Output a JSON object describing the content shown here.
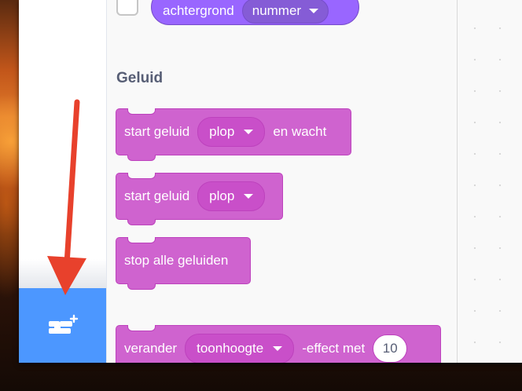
{
  "flyout": {
    "looks_block": {
      "label": "achtergrond",
      "dropdown_value": "nummer"
    },
    "section_sound": {
      "title": "Geluid"
    },
    "blocks": [
      {
        "prefix": "start geluid",
        "dropdown": "plop",
        "suffix": "en wacht"
      },
      {
        "prefix": "start geluid",
        "dropdown": "plop"
      },
      {
        "label": "stop alle geluiden"
      },
      {
        "prefix": "verander",
        "dropdown": "toonhoogte",
        "middle": "-effect met",
        "value": "10"
      }
    ]
  },
  "extension_button": {
    "icon": "add-extension-icon"
  },
  "annotation": {
    "arrow_color": "#e8412c"
  },
  "colors": {
    "sound_block": "#cf63cf",
    "looks_block": "#9966ff",
    "extension_button": "#4c97ff"
  }
}
